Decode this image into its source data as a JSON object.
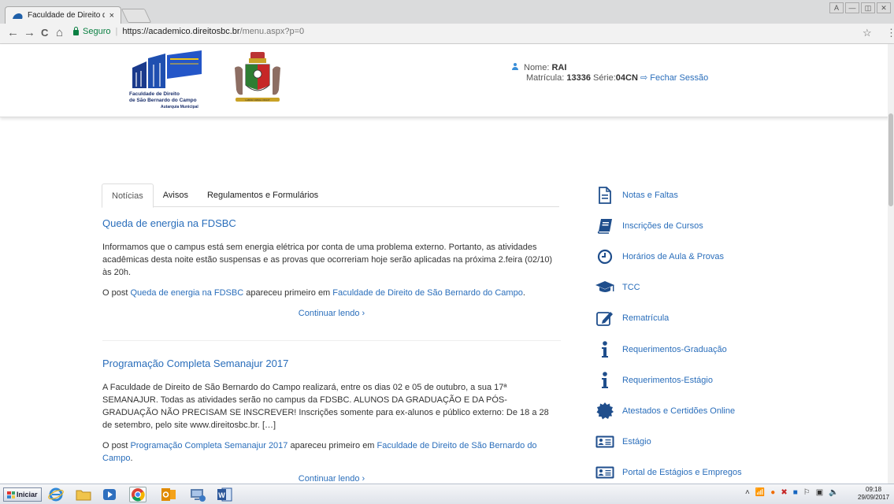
{
  "browser": {
    "tab_title": "Faculdade de Direito de",
    "tab_close": "×",
    "secure_label": "Seguro",
    "url_host": "https://academico.direitosbc.br",
    "url_path": "/menu.aspx?p=0",
    "nav": {
      "back": "←",
      "forward": "→",
      "reload": "C",
      "home": "⌂"
    },
    "bookmark": "☆",
    "menu": "⋮",
    "window_controls": [
      "A",
      "—",
      "◫",
      "✕"
    ]
  },
  "header": {
    "logo_text_line1": "Faculdade de Direito",
    "logo_text_line2": "de São Bernardo do Campo",
    "logo_text_line3": "Autarquia Municipal",
    "crest_motto": "LABOR OMNIA VINCIT",
    "user": {
      "name_label": "Nome:",
      "name": "RAI",
      "matricula_label": "Matrícula:",
      "matricula": "13336",
      "serie_label": "Série:",
      "serie": "04CN",
      "logout": "Fechar Sessão"
    }
  },
  "tabs": [
    {
      "label": "Notícias",
      "active": true
    },
    {
      "label": "Avisos",
      "active": false
    },
    {
      "label": "Regulamentos e Formulários",
      "active": false
    }
  ],
  "posts": [
    {
      "title": "Queda de energia na FDSBC",
      "body": "Informamos que o campus está sem energia elétrica por conta de uma problema externo. Portanto, as atividades acadêmicas desta noite estão suspensas e as provas que ocorreriam hoje serão aplicadas na próxima 2.feira (02/10) às 20h.",
      "footer_prefix": "O post ",
      "footer_link": "Queda de energia na FDSBC",
      "footer_mid": " apareceu primeiro em ",
      "footer_site": "Faculdade de Direito de São Bernardo do Campo",
      "footer_end": ".",
      "more": "Continuar lendo ›"
    },
    {
      "title": "Programação Completa Semanajur 2017",
      "body": "A Faculdade de Direito de São Bernardo do Campo realizará, entre os dias 02 e 05 de outubro, a sua 17ª SEMANAJUR. Todas as atividades serão no campus da FDSBC. ALUNOS DA GRADUAÇÃO E DA PÓS-GRADUAÇÃO NÃO PRECISAM SE INSCREVER! Inscrições somente para ex-alunos e público externo: De 18 a 28 de setembro, pelo site www.direitosbc.br. […]",
      "footer_prefix": "O post ",
      "footer_link": "Programação Completa Semanajur 2017",
      "footer_mid": " apareceu primeiro em ",
      "footer_site": "Faculdade de Direito de São Bernardo do Campo",
      "footer_end": ".",
      "more": "Continuar lendo ›"
    }
  ],
  "side_menu": [
    {
      "label": "Notas e Faltas",
      "icon": "document-icon"
    },
    {
      "label": "Inscrições de Cursos",
      "icon": "book-icon"
    },
    {
      "label": "Horários de Aula & Provas",
      "icon": "clock-icon"
    },
    {
      "label": "TCC",
      "icon": "graduation-cap-icon"
    },
    {
      "label": "Rematrícula",
      "icon": "edit-icon"
    },
    {
      "label": "Requerimentos-Graduação",
      "icon": "info-icon"
    },
    {
      "label": "Requerimentos-Estágio",
      "icon": "info-icon"
    },
    {
      "label": "Atestados e Certidões Online",
      "icon": "certificate-icon"
    },
    {
      "label": "Estágio",
      "icon": "id-card-icon"
    },
    {
      "label": "Portal de Estágios e Empregos",
      "icon": "id-card-icon"
    }
  ],
  "taskbar": {
    "start_label": "Iniciar",
    "clock_time": "09:18",
    "clock_date": "29/09/2017"
  },
  "colors": {
    "link": "#2a6ebb",
    "icon": "#1f4e8c",
    "secure": "#0b8043"
  }
}
